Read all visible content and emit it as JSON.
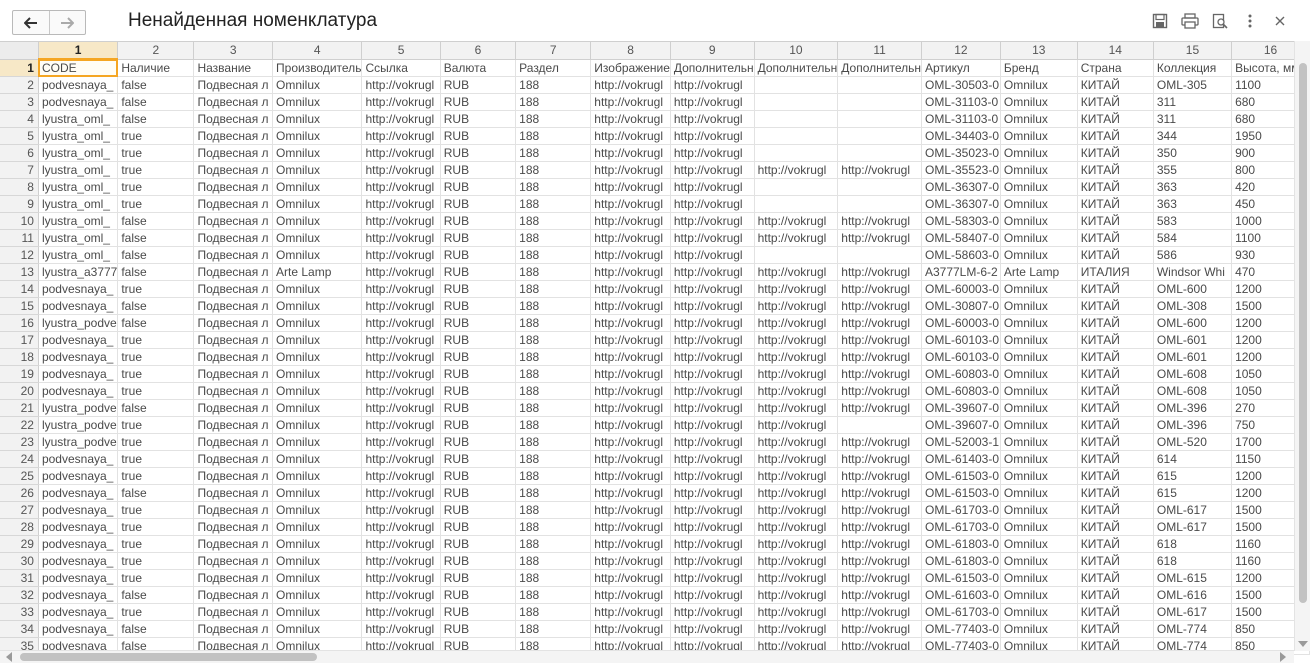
{
  "window": {
    "title": "Ненайденная номенклатура",
    "icons": [
      "arrow-left-icon",
      "arrow-right-icon",
      "save-icon",
      "print-icon",
      "preview-icon",
      "more-vertical-icon",
      "close-icon"
    ]
  },
  "sheet": {
    "col_numbers": [
      "1",
      "2",
      "3",
      "4",
      "5",
      "6",
      "7",
      "8",
      "9",
      "10",
      "11",
      "12",
      "13",
      "14",
      "15",
      "16"
    ],
    "selected_row": 1,
    "selected_col": 1,
    "rows": [
      [
        "CODE",
        "Наличие",
        "Название",
        "Производитель",
        "Ссылка",
        "Валюта",
        "Раздел",
        "Изображение",
        "Дополнительн",
        "Дополнительн",
        "Дополнительн",
        "Артикул",
        "Бренд",
        "Страна",
        "Коллекция",
        "Высота, мм"
      ],
      [
        "podvesnaya_",
        "false",
        "Подвесная л",
        "Omnilux",
        "http://vokrugl",
        "RUB",
        "188",
        "http://vokrugl",
        "http://vokrugl",
        "",
        "",
        "OML-30503-0",
        "Omnilux",
        "КИТАЙ",
        "OML-305",
        "1100"
      ],
      [
        "podvesnaya_",
        "false",
        "Подвесная л",
        "Omnilux",
        "http://vokrugl",
        "RUB",
        "188",
        "http://vokrugl",
        "http://vokrugl",
        "",
        "",
        "OML-31103-0",
        "Omnilux",
        "КИТАЙ",
        "311",
        "680"
      ],
      [
        "lyustra_oml_",
        "false",
        "Подвесная л",
        "Omnilux",
        "http://vokrugl",
        "RUB",
        "188",
        "http://vokrugl",
        "http://vokrugl",
        "",
        "",
        "OML-31103-0",
        "Omnilux",
        "КИТАЙ",
        "311",
        "680"
      ],
      [
        "lyustra_oml_",
        "true",
        "Подвесная л",
        "Omnilux",
        "http://vokrugl",
        "RUB",
        "188",
        "http://vokrugl",
        "http://vokrugl",
        "",
        "",
        "OML-34403-0",
        "Omnilux",
        "КИТАЙ",
        "344",
        "1950"
      ],
      [
        "lyustra_oml_",
        "true",
        "Подвесная л",
        "Omnilux",
        "http://vokrugl",
        "RUB",
        "188",
        "http://vokrugl",
        "http://vokrugl",
        "",
        "",
        "OML-35023-0",
        "Omnilux",
        "КИТАЙ",
        "350",
        "900"
      ],
      [
        "lyustra_oml_",
        "true",
        "Подвесная л",
        "Omnilux",
        "http://vokrugl",
        "RUB",
        "188",
        "http://vokrugl",
        "http://vokrugl",
        "http://vokrugl",
        "http://vokrugl",
        "OML-35523-0",
        "Omnilux",
        "КИТАЙ",
        "355",
        "800"
      ],
      [
        "lyustra_oml_",
        "true",
        "Подвесная л",
        "Omnilux",
        "http://vokrugl",
        "RUB",
        "188",
        "http://vokrugl",
        "http://vokrugl",
        "",
        "",
        "OML-36307-0",
        "Omnilux",
        "КИТАЙ",
        "363",
        "420"
      ],
      [
        "lyustra_oml_",
        "true",
        "Подвесная л",
        "Omnilux",
        "http://vokrugl",
        "RUB",
        "188",
        "http://vokrugl",
        "http://vokrugl",
        "",
        "",
        "OML-36307-0",
        "Omnilux",
        "КИТАЙ",
        "363",
        "450"
      ],
      [
        "lyustra_oml_",
        "false",
        "Подвесная л",
        "Omnilux",
        "http://vokrugl",
        "RUB",
        "188",
        "http://vokrugl",
        "http://vokrugl",
        "http://vokrugl",
        "http://vokrugl",
        "OML-58303-0",
        "Omnilux",
        "КИТАЙ",
        "583",
        "1000"
      ],
      [
        "lyustra_oml_",
        "false",
        "Подвесная л",
        "Omnilux",
        "http://vokrugl",
        "RUB",
        "188",
        "http://vokrugl",
        "http://vokrugl",
        "http://vokrugl",
        "http://vokrugl",
        "OML-58407-0",
        "Omnilux",
        "КИТАЙ",
        "584",
        "1100"
      ],
      [
        "lyustra_oml_",
        "false",
        "Подвесная л",
        "Omnilux",
        "http://vokrugl",
        "RUB",
        "188",
        "http://vokrugl",
        "http://vokrugl",
        "",
        "",
        "OML-58603-0",
        "Omnilux",
        "КИТАЙ",
        "586",
        "930"
      ],
      [
        "lyustra_a3777",
        "false",
        "Подвесная л",
        "Arte Lamp",
        "http://vokrugl",
        "RUB",
        "188",
        "http://vokrugl",
        "http://vokrugl",
        "http://vokrugl",
        "http://vokrugl",
        "A3777LM-6-2",
        "Arte Lamp",
        "ИТАЛИЯ",
        "Windsor Whi",
        "470"
      ],
      [
        "podvesnaya_",
        "true",
        "Подвесная л",
        "Omnilux",
        "http://vokrugl",
        "RUB",
        "188",
        "http://vokrugl",
        "http://vokrugl",
        "http://vokrugl",
        "http://vokrugl",
        "OML-60003-0",
        "Omnilux",
        "КИТАЙ",
        "OML-600",
        "1200"
      ],
      [
        "podvesnaya_",
        "false",
        "Подвесная л",
        "Omnilux",
        "http://vokrugl",
        "RUB",
        "188",
        "http://vokrugl",
        "http://vokrugl",
        "http://vokrugl",
        "http://vokrugl",
        "OML-30807-0",
        "Omnilux",
        "КИТАЙ",
        "OML-308",
        "1500"
      ],
      [
        "lyustra_podve",
        "false",
        "Подвесная л",
        "Omnilux",
        "http://vokrugl",
        "RUB",
        "188",
        "http://vokrugl",
        "http://vokrugl",
        "http://vokrugl",
        "http://vokrugl",
        "OML-60003-0",
        "Omnilux",
        "КИТАЙ",
        "OML-600",
        "1200"
      ],
      [
        "podvesnaya_",
        "true",
        "Подвесная л",
        "Omnilux",
        "http://vokrugl",
        "RUB",
        "188",
        "http://vokrugl",
        "http://vokrugl",
        "http://vokrugl",
        "http://vokrugl",
        "OML-60103-0",
        "Omnilux",
        "КИТАЙ",
        "OML-601",
        "1200"
      ],
      [
        "podvesnaya_",
        "true",
        "Подвесная л",
        "Omnilux",
        "http://vokrugl",
        "RUB",
        "188",
        "http://vokrugl",
        "http://vokrugl",
        "http://vokrugl",
        "http://vokrugl",
        "OML-60103-0",
        "Omnilux",
        "КИТАЙ",
        "OML-601",
        "1200"
      ],
      [
        "podvesnaya_",
        "true",
        "Подвесная л",
        "Omnilux",
        "http://vokrugl",
        "RUB",
        "188",
        "http://vokrugl",
        "http://vokrugl",
        "http://vokrugl",
        "http://vokrugl",
        "OML-60803-0",
        "Omnilux",
        "КИТАЙ",
        "OML-608",
        "1050"
      ],
      [
        "podvesnaya_",
        "true",
        "Подвесная л",
        "Omnilux",
        "http://vokrugl",
        "RUB",
        "188",
        "http://vokrugl",
        "http://vokrugl",
        "http://vokrugl",
        "http://vokrugl",
        "OML-60803-0",
        "Omnilux",
        "КИТАЙ",
        "OML-608",
        "1050"
      ],
      [
        "lyustra_podve",
        "false",
        "Подвесная л",
        "Omnilux",
        "http://vokrugl",
        "RUB",
        "188",
        "http://vokrugl",
        "http://vokrugl",
        "http://vokrugl",
        "http://vokrugl",
        "OML-39607-0",
        "Omnilux",
        "КИТАЙ",
        "OML-396",
        "270"
      ],
      [
        "lyustra_podve",
        "true",
        "Подвесная л",
        "Omnilux",
        "http://vokrugl",
        "RUB",
        "188",
        "http://vokrugl",
        "http://vokrugl",
        "http://vokrugl",
        "",
        "OML-39607-0",
        "Omnilux",
        "КИТАЙ",
        "OML-396",
        "750"
      ],
      [
        "lyustra_podve",
        "true",
        "Подвесная л",
        "Omnilux",
        "http://vokrugl",
        "RUB",
        "188",
        "http://vokrugl",
        "http://vokrugl",
        "http://vokrugl",
        "http://vokrugl",
        "OML-52003-1",
        "Omnilux",
        "КИТАЙ",
        "OML-520",
        "1700"
      ],
      [
        "podvesnaya_",
        "true",
        "Подвесная л",
        "Omnilux",
        "http://vokrugl",
        "RUB",
        "188",
        "http://vokrugl",
        "http://vokrugl",
        "http://vokrugl",
        "http://vokrugl",
        "OML-61403-0",
        "Omnilux",
        "КИТАЙ",
        "614",
        "1150"
      ],
      [
        "podvesnaya_",
        "true",
        "Подвесная л",
        "Omnilux",
        "http://vokrugl",
        "RUB",
        "188",
        "http://vokrugl",
        "http://vokrugl",
        "http://vokrugl",
        "http://vokrugl",
        "OML-61503-0",
        "Omnilux",
        "КИТАЙ",
        "615",
        "1200"
      ],
      [
        "podvesnaya_",
        "false",
        "Подвесная л",
        "Omnilux",
        "http://vokrugl",
        "RUB",
        "188",
        "http://vokrugl",
        "http://vokrugl",
        "http://vokrugl",
        "http://vokrugl",
        "OML-61503-0",
        "Omnilux",
        "КИТАЙ",
        "615",
        "1200"
      ],
      [
        "podvesnaya_",
        "true",
        "Подвесная л",
        "Omnilux",
        "http://vokrugl",
        "RUB",
        "188",
        "http://vokrugl",
        "http://vokrugl",
        "http://vokrugl",
        "http://vokrugl",
        "OML-61703-0",
        "Omnilux",
        "КИТАЙ",
        "OML-617",
        "1500"
      ],
      [
        "podvesnaya_",
        "true",
        "Подвесная л",
        "Omnilux",
        "http://vokrugl",
        "RUB",
        "188",
        "http://vokrugl",
        "http://vokrugl",
        "http://vokrugl",
        "http://vokrugl",
        "OML-61703-0",
        "Omnilux",
        "КИТАЙ",
        "OML-617",
        "1500"
      ],
      [
        "podvesnaya_",
        "true",
        "Подвесная л",
        "Omnilux",
        "http://vokrugl",
        "RUB",
        "188",
        "http://vokrugl",
        "http://vokrugl",
        "http://vokrugl",
        "http://vokrugl",
        "OML-61803-0",
        "Omnilux",
        "КИТАЙ",
        "618",
        "1160"
      ],
      [
        "podvesnaya_",
        "true",
        "Подвесная л",
        "Omnilux",
        "http://vokrugl",
        "RUB",
        "188",
        "http://vokrugl",
        "http://vokrugl",
        "http://vokrugl",
        "http://vokrugl",
        "OML-61803-0",
        "Omnilux",
        "КИТАЙ",
        "618",
        "1160"
      ],
      [
        "podvesnaya_",
        "true",
        "Подвесная л",
        "Omnilux",
        "http://vokrugl",
        "RUB",
        "188",
        "http://vokrugl",
        "http://vokrugl",
        "http://vokrugl",
        "http://vokrugl",
        "OML-61503-0",
        "Omnilux",
        "КИТАЙ",
        "OML-615",
        "1200"
      ],
      [
        "podvesnaya_",
        "false",
        "Подвесная л",
        "Omnilux",
        "http://vokrugl",
        "RUB",
        "188",
        "http://vokrugl",
        "http://vokrugl",
        "http://vokrugl",
        "http://vokrugl",
        "OML-61603-0",
        "Omnilux",
        "КИТАЙ",
        "OML-616",
        "1500"
      ],
      [
        "podvesnaya_",
        "true",
        "Подвесная л",
        "Omnilux",
        "http://vokrugl",
        "RUB",
        "188",
        "http://vokrugl",
        "http://vokrugl",
        "http://vokrugl",
        "http://vokrugl",
        "OML-61703-0",
        "Omnilux",
        "КИТАЙ",
        "OML-617",
        "1500"
      ],
      [
        "podvesnaya_",
        "false",
        "Подвесная л",
        "Omnilux",
        "http://vokrugl",
        "RUB",
        "188",
        "http://vokrugl",
        "http://vokrugl",
        "http://vokrugl",
        "http://vokrugl",
        "OML-77403-0",
        "Omnilux",
        "КИТАЙ",
        "OML-774",
        "850"
      ],
      [
        "podvesnaya_",
        "false",
        "Подвесная л",
        "Omnilux",
        "http://vokrugl",
        "RUB",
        "188",
        "http://vokrugl",
        "http://vokrugl",
        "http://vokrugl",
        "http://vokrugl",
        "OML-77403-0",
        "Omnilux",
        "КИТАЙ",
        "OML-774",
        "850"
      ]
    ]
  },
  "colors": {
    "accent": "#f5a623",
    "header_bg": "#f2f2f2",
    "grid_line": "#e2e2e2"
  }
}
